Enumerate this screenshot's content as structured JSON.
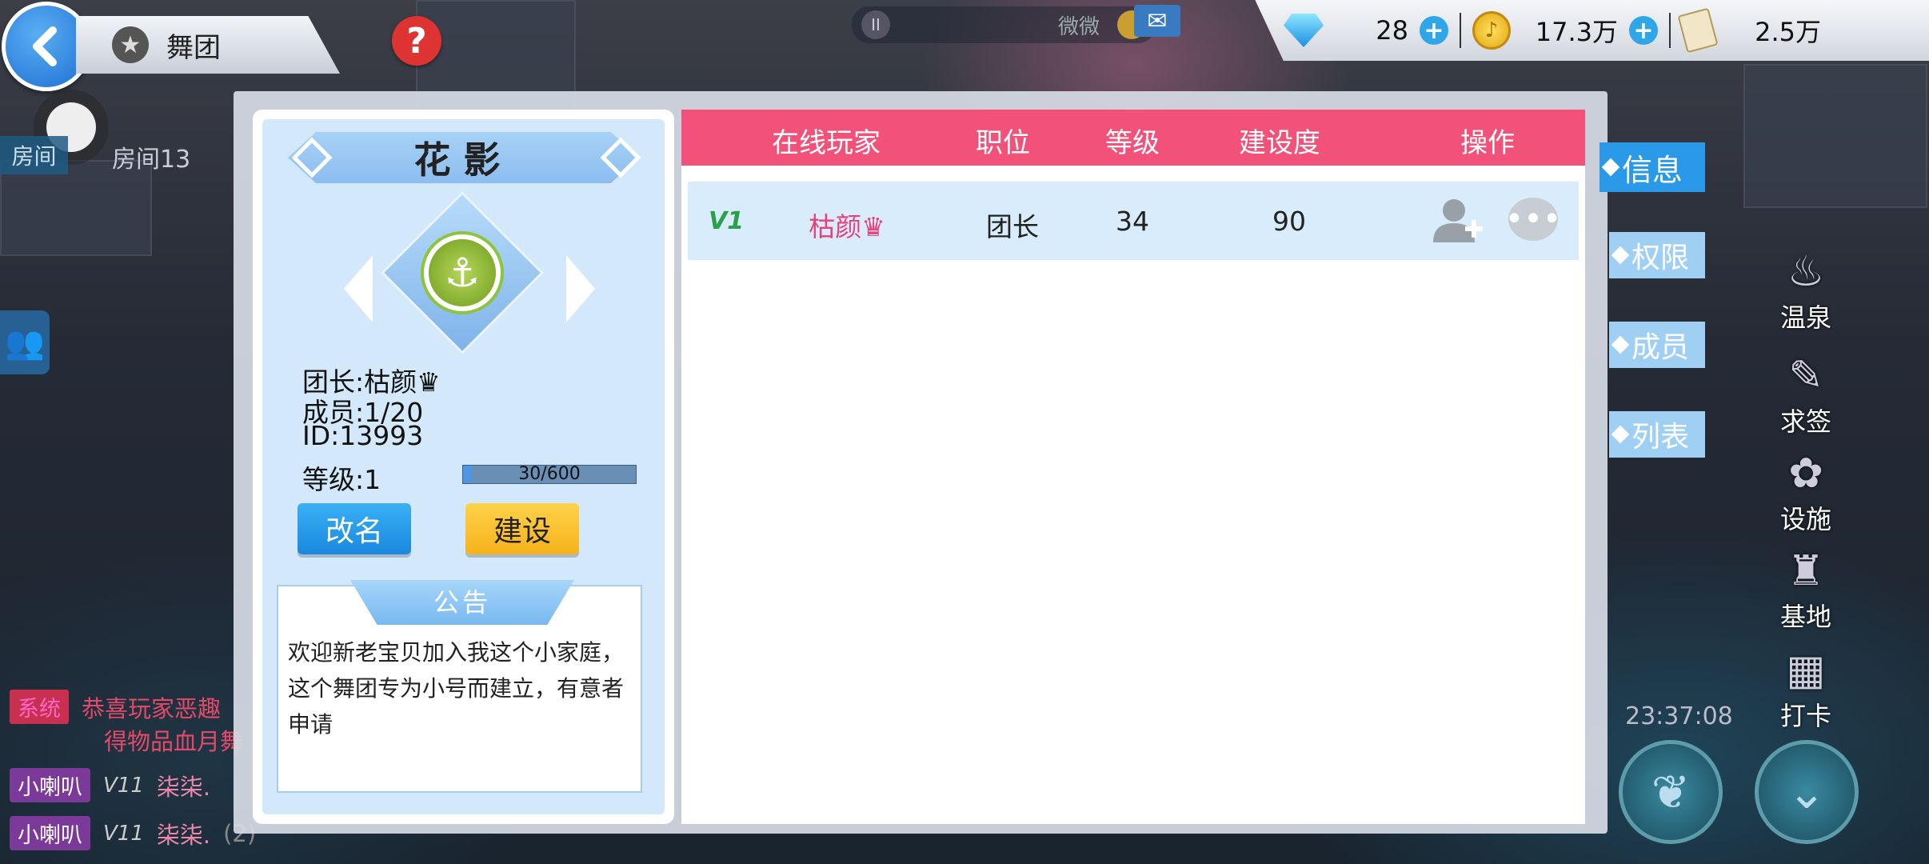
{
  "header": {
    "title": "舞团",
    "help": "?",
    "star": "★"
  },
  "room": {
    "tag": "房间",
    "name": "房间13"
  },
  "top_status": {
    "user": "微微"
  },
  "currency": {
    "diamonds": "28",
    "gold": "17.3万",
    "tickets": "2.5万"
  },
  "guild": {
    "name": "花影",
    "leader": "团长:枯颜♛",
    "members": "成员:1/20",
    "id": "ID:13993",
    "level": "等级:1",
    "progress_text": "30/600",
    "progress_fraction": 0.05,
    "rename_label": "改名",
    "build_label": "建设",
    "notice_title": "公告",
    "notice_text": "欢迎新老宝贝加入我这个小家庭，这个舞团专为小号而建立，有意者申请"
  },
  "table": {
    "columns": [
      "在线玩家",
      "职位",
      "等级",
      "建设度",
      "操作"
    ],
    "rows": [
      {
        "vip": "V1",
        "name": "枯颜♛",
        "position": "团长",
        "level": "34",
        "contribution": "90"
      }
    ]
  },
  "side_tabs": [
    "信息",
    "权限",
    "成员",
    "列表"
  ],
  "right_icons": [
    "温泉",
    "求签",
    "设施",
    "基地",
    "打卡"
  ],
  "clock": "23:37:08",
  "chat": [
    {
      "channel": "系统",
      "text": "恭喜玩家恶趣",
      "text2": "得物品血月舞"
    },
    {
      "channel": "小喇叭",
      "vip": "V11",
      "text": "柒柒."
    },
    {
      "channel": "小喇叭",
      "vip": "V11",
      "text": "柒柒.",
      "extra": "(2)"
    }
  ],
  "colors": {
    "header_pink": "#f2527a",
    "tab_active": "#2a9ae8",
    "build_yellow": "#f6b21a",
    "rename_blue": "#1a88df"
  }
}
